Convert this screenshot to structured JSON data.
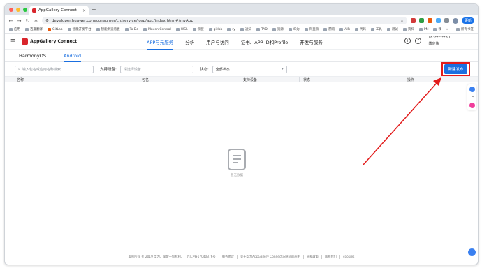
{
  "browser": {
    "tab_title": "AppGallery Connect",
    "close_icon": "×",
    "new_tab": "+",
    "url": "developer.huawei.com/consumer/cn/service/josp/agc/index.html#/myApp",
    "update_label": "更新"
  },
  "bookmarks": {
    "items": [
      "应用",
      "百度翻译",
      "GitLab",
      "智能开发平台",
      "智能制造看板",
      "To Do",
      "Maven Central",
      "WSL",
      "云服",
      "gitlab",
      "ry",
      "通知",
      "TAD",
      "资源",
      "华为",
      "阿里云",
      "腾讯",
      "AIR",
      "代码",
      "工具",
      "测试",
      "资料",
      "PM",
      "我"
    ],
    "more": "»",
    "all_label": "所有书签"
  },
  "app": {
    "brand": "AppGallery Connect",
    "nav": [
      "APP与元服务",
      "分析",
      "用户与访问",
      "证书、APP ID和Profile",
      "开发与服务"
    ],
    "active_nav": 0,
    "user_id": "183******30",
    "user_name": "傅晓伟"
  },
  "platform_tabs": [
    "HarmonyOS",
    "Android"
  ],
  "active_platform": 1,
  "filters": {
    "search_placeholder": "输入包名或应用名称搜索",
    "device_label": "支持设备:",
    "device_placeholder": "请选择设备",
    "status_label": "状态:",
    "status_value": "全部状态",
    "new_release_button": "新建发布"
  },
  "table": {
    "columns": [
      "名称",
      "包名",
      "支持设备",
      "状态",
      "操作"
    ]
  },
  "empty_state": {
    "text": "暂无数据"
  },
  "footer": {
    "items": [
      "版权所有 © 2019 华为。保留一切权利。",
      "苏ICP备17040376号",
      "服务协议",
      "关于华为AppGallery Connect与隐私的声明",
      "隐私政策",
      "联系我们",
      "cookies"
    ]
  },
  "colors": {
    "accent": "#1a6fe0",
    "highlight": "#e21b1b",
    "brand_red": "#d9252c"
  }
}
